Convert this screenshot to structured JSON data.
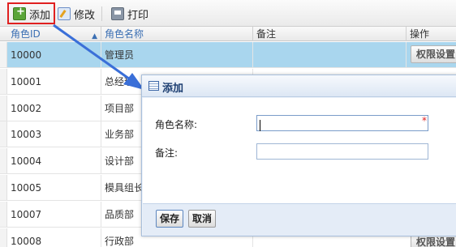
{
  "toolbar": {
    "add_label": "添加",
    "edit_label": "修改",
    "print_label": "打印"
  },
  "grid": {
    "columns": [
      "角色ID",
      "角色名称",
      "备注",
      "操作"
    ],
    "sort_indicator": "▲",
    "action_label": "权限设置",
    "rows": [
      {
        "id": "10000",
        "name": "管理员",
        "note": ""
      },
      {
        "id": "10001",
        "name": "总经理",
        "note": ""
      },
      {
        "id": "10002",
        "name": "项目部",
        "note": ""
      },
      {
        "id": "10003",
        "name": "业务部",
        "note": ""
      },
      {
        "id": "10004",
        "name": "设计部",
        "note": ""
      },
      {
        "id": "10005",
        "name": "模具组长",
        "note": ""
      },
      {
        "id": "10007",
        "name": "品质部",
        "note": ""
      },
      {
        "id": "10008",
        "name": "行政部",
        "note": ""
      }
    ]
  },
  "dialog": {
    "title": "添加",
    "name_label": "角色名称:",
    "name_value": "",
    "note_label": "备注:",
    "note_value": "",
    "required_mark": "*",
    "save_label": "保存",
    "cancel_label": "取消"
  },
  "colors": {
    "highlight": "#e02020",
    "arrow": "#3a6fd8",
    "selected_row": "#a9d6ee",
    "header_text": "#3b6fb3"
  }
}
